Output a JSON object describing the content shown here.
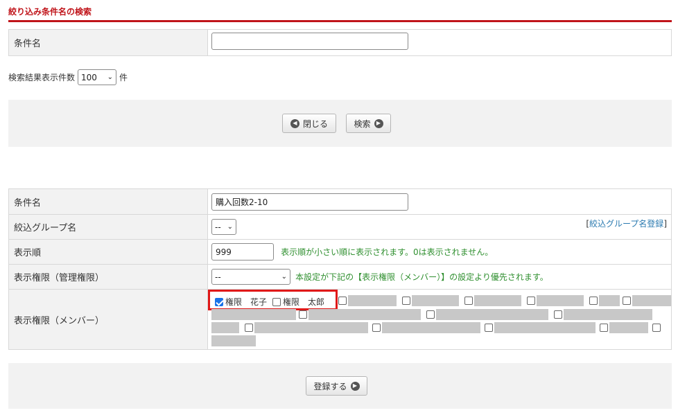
{
  "search_panel": {
    "title": "絞り込み条件名の検索",
    "condition_label": "条件名",
    "condition_value": "",
    "result_count_label": "検索結果表示件数",
    "result_count_value": "100",
    "result_count_unit": "件",
    "close_button": "閉じる",
    "search_button": "検索"
  },
  "edit_form": {
    "condition_label": "条件名",
    "condition_value": "購入回数2-10",
    "group_label": "絞込グループ名",
    "group_value": "--",
    "group_register_link": "絞込グループ名登録",
    "bracket_open": "[",
    "bracket_close": "]",
    "order_label": "表示順",
    "order_value": "999",
    "order_hint": "表示順が小さい順に表示されます。0は表示されません。",
    "admin_perm_label": "表示権限（管理権限）",
    "admin_perm_value": "--",
    "admin_perm_hint": "本設定が下記の【表示権限（メンバー）】の設定より優先されます。",
    "member_perm_label": "表示権限（メンバー）",
    "members": [
      {
        "name": "権限　花子",
        "checked": true
      },
      {
        "name": "権限　太郎",
        "checked": false
      }
    ],
    "register_button": "登録する"
  },
  "colors": {
    "accent": "#c0141a",
    "hint": "#2f8f2f",
    "link": "#2a7ab0",
    "highlight_box": "#e01818"
  }
}
